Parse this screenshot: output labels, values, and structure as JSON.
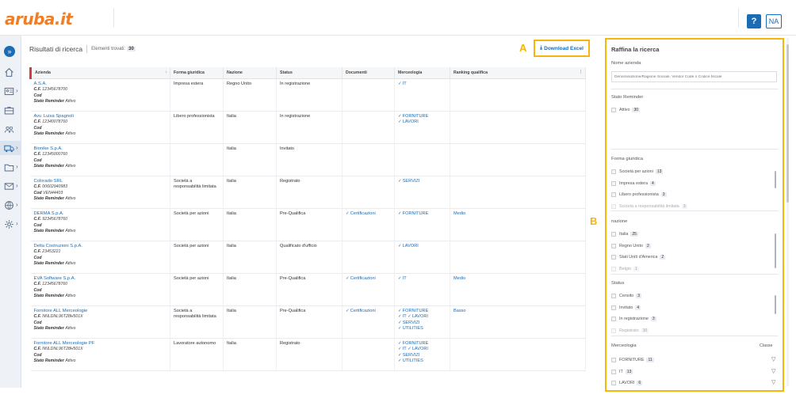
{
  "app": {
    "logo_text": "aruba.it",
    "help_label": "?",
    "user_initials": "NA"
  },
  "nav": [
    {
      "icon": "double-chevron-right-icon"
    },
    {
      "icon": "home-icon"
    },
    {
      "icon": "id-card-icon"
    },
    {
      "icon": "briefcase-icon"
    },
    {
      "icon": "users-icon"
    },
    {
      "icon": "truck-icon"
    },
    {
      "icon": "folder-icon"
    },
    {
      "icon": "mail-icon"
    },
    {
      "icon": "globe-icon"
    },
    {
      "icon": "gear-icon"
    }
  ],
  "page": {
    "title": "Risultati di ricerca",
    "found_label": "Elementi trovati:",
    "found_count": "30",
    "download_label": "Download Excel",
    "marker_a": "A",
    "marker_b": "B"
  },
  "table": {
    "columns": [
      "Azienda",
      "Forma giuridica",
      "Nazione",
      "Status",
      "Documenti",
      "Merceologia",
      "Ranking qualifica"
    ],
    "labels": {
      "cf": "C.F.",
      "cod": "Cod",
      "stato": "Stato Reminder"
    },
    "rows": [
      {
        "name": "A.S.A.",
        "cf": "12345678700",
        "stato": "Attivo",
        "forma": "Impresa estera",
        "nazione": "Regno Unito",
        "status": "In registrazione",
        "documenti": "",
        "merc": [
          "IT"
        ],
        "ranking": ""
      },
      {
        "name": "Avv. Luisa Spagnoli",
        "cf": "12340078760",
        "stato": "Attivo",
        "forma": "Libero professionista",
        "nazione": "Italia",
        "status": "In registrazione",
        "documenti": "",
        "merc": [
          "FORNITURE",
          "LAVORI"
        ],
        "ranking": ""
      },
      {
        "name": "Bionike S.p.A.",
        "cf": "12345000760",
        "stato": "Attivo",
        "forma": "",
        "nazione": "Italia",
        "status": "Invitato",
        "documenti": "",
        "merc": [],
        "ranking": ""
      },
      {
        "name": "Colorado SRL",
        "cf": "00602940983",
        "cod": "VEN44403",
        "stato": "Attivo",
        "forma": "Società a responsabilità limitata",
        "nazione": "Italia",
        "status": "Registrato",
        "documenti": "",
        "merc": [
          "SERVIZI"
        ],
        "ranking": ""
      },
      {
        "name": "DERMA S.p.A.",
        "cf": "92345678760",
        "stato": "Attivo",
        "forma": "Società per azioni",
        "nazione": "Italia",
        "status": "Pre-Qualifica",
        "documenti": "Certificazioni",
        "merc": [
          "FORNITURE"
        ],
        "ranking": "Medio"
      },
      {
        "name": "Delta Costruzioni S.p.A.",
        "cf": "23453221",
        "stato": "Attivo",
        "forma": "Società per azioni",
        "nazione": "Italia",
        "status": "Qualificato d'ufficio",
        "documenti": "",
        "merc": [
          "LAVORI"
        ],
        "ranking": ""
      },
      {
        "name": "EVA Software S.p.A.",
        "cf": "12345678760",
        "stato": "Attivo",
        "forma": "Società per azioni",
        "nazione": "Italia",
        "status": "Pre-Qualifica",
        "documenti": "Certificazioni",
        "merc": [
          "IT"
        ],
        "ranking": "Medio"
      },
      {
        "name": "Fornitore ALL Merceologie",
        "cf": "NNLDNL96T28H501X",
        "stato": "Attivo",
        "forma": "Società a responsabilità limitata",
        "nazione": "Italia",
        "status": "Pre-Qualifica",
        "documenti": "Certificazioni",
        "merc": [
          "FORNITURE",
          "IT",
          "LAVORI",
          "SERVIZI",
          "UTILITIES"
        ],
        "ranking": "Basso"
      },
      {
        "name": "Fornitore ALL Merceologie PF",
        "cf": "NNLDNL96T28H501X",
        "stato": "Attivo",
        "forma": "Lavoratore autonomo",
        "nazione": "Italia",
        "status": "Registrato",
        "documenti": "",
        "merc": [
          "FORNITURE",
          "IT",
          "LAVORI",
          "SERVIZI",
          "UTILITIES"
        ],
        "ranking": ""
      }
    ]
  },
  "filters": {
    "title": "Raffina la ricerca",
    "nome_label": "Nome azienda",
    "nome_placeholder": "Denominazione/Ragione Sociale, Vendor Code o Codice fiscale",
    "stato_label": "Stato Reminder",
    "stato_opts": [
      {
        "label": "Attivo",
        "count": "30"
      }
    ],
    "forma_label": "Forma giuridica",
    "forma_opts": [
      {
        "label": "Società per azioni",
        "count": "13"
      },
      {
        "label": "Impresa estera",
        "count": "4"
      },
      {
        "label": "Libero professionista",
        "count": "3"
      },
      {
        "label": "Società a responsabilità limitata",
        "count": "3"
      }
    ],
    "nazione_label": "nazione",
    "nazione_opts": [
      {
        "label": "Italia",
        "count": "25"
      },
      {
        "label": "Regno Unito",
        "count": "2"
      },
      {
        "label": "Stati Uniti d'America",
        "count": "2"
      },
      {
        "label": "Belgio",
        "count": "1"
      }
    ],
    "status_label": "Status",
    "status_opts": [
      {
        "label": "Censito",
        "count": "3"
      },
      {
        "label": "Invitato",
        "count": "4"
      },
      {
        "label": "In registrazione",
        "count": "3"
      },
      {
        "label": "Registrato",
        "count": "10"
      }
    ],
    "merc_label": "Merceologia",
    "classe_label": "Classe",
    "merc_opts": [
      {
        "label": "FORNITURE",
        "count": "11"
      },
      {
        "label": "IT",
        "count": "13"
      },
      {
        "label": "LAVORI",
        "count": "6"
      }
    ]
  }
}
